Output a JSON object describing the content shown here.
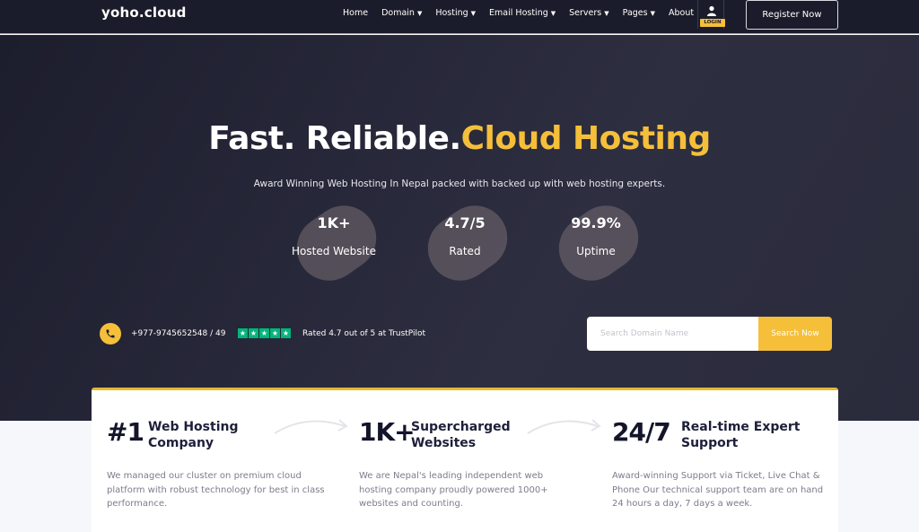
{
  "header": {
    "logo": "yoho.cloud",
    "nav": [
      {
        "label": "Home",
        "dropdown": false
      },
      {
        "label": "Domain",
        "dropdown": true
      },
      {
        "label": "Hosting",
        "dropdown": true
      },
      {
        "label": "Email Hosting",
        "dropdown": true
      },
      {
        "label": "Servers",
        "dropdown": true
      },
      {
        "label": "Pages",
        "dropdown": true
      },
      {
        "label": "About",
        "dropdown": false
      }
    ],
    "login_label": "LOGIN",
    "register_label": "Register Now"
  },
  "hero": {
    "headline_white": "Fast. Reliable.",
    "headline_accent": "Cloud Hosting",
    "subline": "Award Winning Web Hosting In Nepal packed with backed up with web hosting experts.",
    "stats": [
      {
        "value": "1K+",
        "label": "Hosted Website"
      },
      {
        "value": "4.7/5",
        "label": "Rated"
      },
      {
        "value": "99.9%",
        "label": "Uptime"
      }
    ],
    "phone": "+977-9745652548 / 49",
    "rating_stars": 5,
    "trust_text": "Rated 4.7 out of 5 at TrustPilot",
    "search": {
      "placeholder": "Search Domain Name",
      "button": "Search Now"
    }
  },
  "features": [
    {
      "big": "#1",
      "title": "Web Hosting Company",
      "desc": "We managed our cluster on premium cloud platform with robust technology for best in class performance."
    },
    {
      "big": "1K+",
      "title": "Supercharged Websites",
      "desc": "We are Nepal's leading independent web hosting company proudly powered 1000+ websites and counting."
    },
    {
      "big": "24/7",
      "title": "Real-time Expert Support",
      "desc": "Award-winning Support via Ticket, Live Chat & Phone Our technical support team are on hand 24 hours a day, 7 days a week."
    }
  ],
  "colors": {
    "accent": "#f5bf3a",
    "dark": "#1b1c2b",
    "trustpilot": "#00b67a"
  }
}
